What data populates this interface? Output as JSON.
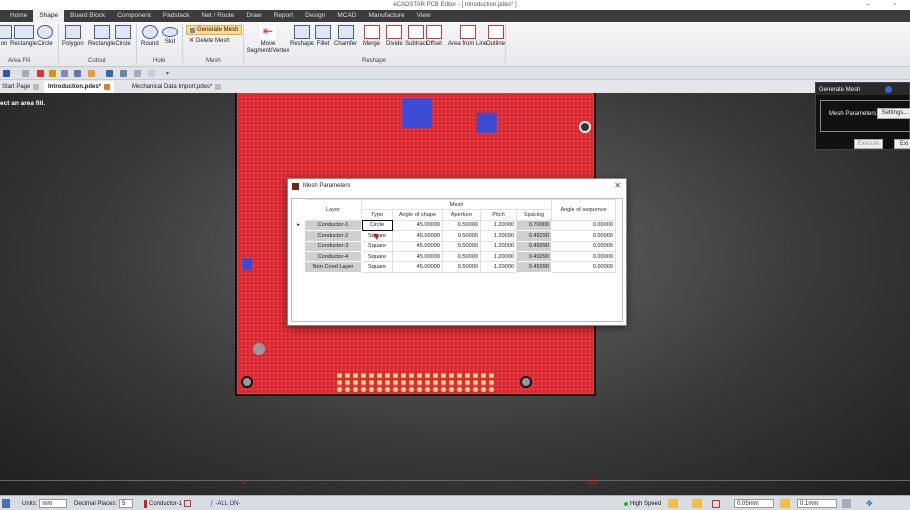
{
  "window": {
    "title": "eCADSTAR PCB Editor - [ Introduction.pdes* ]"
  },
  "menu": [
    "Home",
    "Shape",
    "Board Block",
    "Component",
    "Padstack",
    "Net / Route",
    "Draw",
    "Report",
    "Design",
    "MCAD",
    "Manufacture",
    "View"
  ],
  "menu_active": "Shape",
  "ribbon": {
    "area_fill": {
      "label": "Area Fill",
      "items": [
        "on",
        "Rectangle",
        "Circle"
      ]
    },
    "cutout": {
      "label": "Cutout",
      "items": [
        "Polygon",
        "Rectangle",
        "Circle"
      ]
    },
    "hole": {
      "label": "Hole",
      "items": [
        "Round",
        "Slot"
      ]
    },
    "mesh": {
      "label": "Mesh",
      "generate": "Generate Mesh",
      "delete": "Delete Mesh"
    },
    "reshape": {
      "label": "Reshape",
      "move": "Move Segment/Vertex",
      "items": [
        "Reshape",
        "Fillet",
        "Chamfer",
        "Merge",
        "Divide",
        "Subtract",
        "Offset",
        "Area from Line",
        "Outline"
      ]
    }
  },
  "doc_tabs": [
    {
      "label": "Start Page"
    },
    {
      "label": "Introduction.pdes*",
      "active": true
    },
    {
      "label": "Mechanical Data Import.pdes*"
    }
  ],
  "canvas": {
    "hint": "ect an area fill.",
    "ruler": [
      "0",
      "100"
    ],
    "board_color": "#d8262e"
  },
  "generate_mesh_panel": {
    "title": "Generate Mesh",
    "label": "Mesh Parameters:",
    "settings": "Settings...",
    "execute": "Execute",
    "exit": "Exi"
  },
  "dialog": {
    "title": "Mesh Parameters",
    "headers": {
      "layer": "Layer",
      "mesh": "Mesh",
      "type": "Type",
      "angle_shape": "Angle of shape",
      "aperture": "Aperture",
      "pitch": "Pitch",
      "spacing": "Spacing",
      "angle_seq": "Angle of sequence"
    },
    "rows": [
      {
        "layer": "Conductor-1",
        "type": "Circle",
        "angle": "45.00000",
        "aperture": "0.50000",
        "pitch": "1.20000",
        "spacing": "0.70000",
        "seq": "0.00000"
      },
      {
        "layer": "Conductor-2",
        "type": "Square",
        "angle": "45.00000",
        "aperture": "0.50000",
        "pitch": "1.20000",
        "spacing": "0.49290",
        "seq": "0.00000"
      },
      {
        "layer": "Conductor-3",
        "type": "Square",
        "angle": "45.00000",
        "aperture": "0.50000",
        "pitch": "1.20000",
        "spacing": "0.49290",
        "seq": "0.00000"
      },
      {
        "layer": "Conductor-4",
        "type": "Square",
        "angle": "45.00000",
        "aperture": "0.50000",
        "pitch": "1.20000",
        "spacing": "0.49290",
        "seq": "0.00000"
      },
      {
        "layer": "Non Cond Layer",
        "type": "Square",
        "angle": "45.00000",
        "aperture": "0.50000",
        "pitch": "1.20000",
        "spacing": "0.49290",
        "seq": "0.00000"
      }
    ]
  },
  "status": {
    "units_label": "Units:",
    "units": "mm",
    "decimal_label": "Decimal Places:",
    "decimal": "5",
    "layer": "Conductor-1",
    "filter": "-ALL ON-",
    "speed": "High Speed",
    "grid1": "0.05mm",
    "grid2": "0.1mm"
  }
}
